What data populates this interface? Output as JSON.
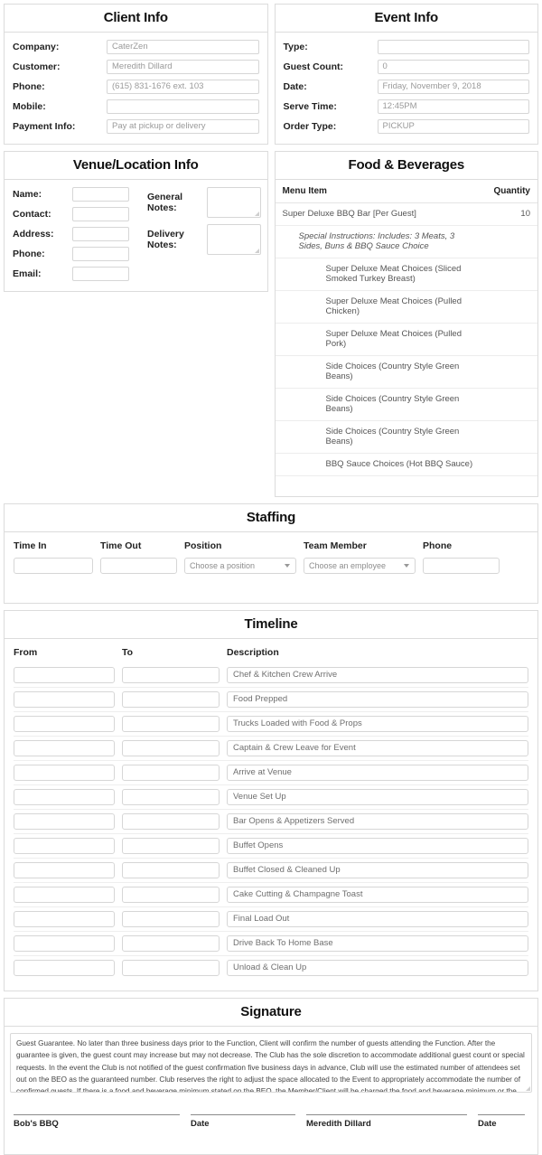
{
  "client_info": {
    "title": "Client Info",
    "fields": [
      {
        "label": "Company:",
        "value": "CaterZen"
      },
      {
        "label": "Customer:",
        "value": "Meredith Dillard"
      },
      {
        "label": "Phone:",
        "value": "(615) 831-1676 ext. 103"
      },
      {
        "label": "Mobile:",
        "value": ""
      },
      {
        "label": "Payment Info:",
        "value": "Pay at pickup or delivery"
      }
    ]
  },
  "event_info": {
    "title": "Event Info",
    "fields": [
      {
        "label": "Type:",
        "value": ""
      },
      {
        "label": "Guest Count:",
        "value": "0"
      },
      {
        "label": "Date:",
        "value": "Friday, November 9, 2018"
      },
      {
        "label": "Serve Time:",
        "value": "12:45PM"
      },
      {
        "label": "Order Type:",
        "value": "PICKUP"
      }
    ]
  },
  "venue_info": {
    "title": "Venue/Location Info",
    "fields": [
      {
        "label": "Name:",
        "value": ""
      },
      {
        "label": "Contact:",
        "value": ""
      },
      {
        "label": "Address:",
        "value": ""
      },
      {
        "label": "Phone:",
        "value": ""
      },
      {
        "label": "Email:",
        "value": ""
      }
    ],
    "notes": [
      {
        "label": "General Notes:",
        "value": ""
      },
      {
        "label": "Delivery Notes:",
        "value": ""
      }
    ]
  },
  "food_beverages": {
    "title": "Food & Beverages",
    "columns": {
      "item": "Menu Item",
      "quantity": "Quantity"
    },
    "rows": [
      {
        "indent": 0,
        "text": "Super Deluxe BBQ Bar [Per Guest]",
        "quantity": "10"
      },
      {
        "indent": 1,
        "text": "Special Instructions: Includes: 3 Meats, 3 Sides, Buns & BBQ Sauce Choice",
        "quantity": ""
      },
      {
        "indent": 2,
        "text": "Super Deluxe Meat Choices (Sliced Smoked Turkey Breast)",
        "quantity": ""
      },
      {
        "indent": 2,
        "text": "Super Deluxe Meat Choices (Pulled Chicken)",
        "quantity": ""
      },
      {
        "indent": 2,
        "text": "Super Deluxe Meat Choices (Pulled Pork)",
        "quantity": ""
      },
      {
        "indent": 2,
        "text": "Side Choices (Country Style Green Beans)",
        "quantity": ""
      },
      {
        "indent": 2,
        "text": "Side Choices (Country Style Green Beans)",
        "quantity": ""
      },
      {
        "indent": 2,
        "text": "Side Choices (Country Style Green Beans)",
        "quantity": ""
      },
      {
        "indent": 2,
        "text": "BBQ Sauce Choices (Hot BBQ Sauce)",
        "quantity": ""
      }
    ]
  },
  "staffing": {
    "title": "Staffing",
    "columns": [
      "Time In",
      "Time Out",
      "Position",
      "Team Member",
      "Phone"
    ],
    "row": {
      "time_in": "",
      "time_out": "",
      "position_placeholder": "Choose a position",
      "team_member_placeholder": "Choose an employee",
      "phone": ""
    }
  },
  "timeline": {
    "title": "Timeline",
    "columns": [
      "From",
      "To",
      "Description"
    ],
    "rows": [
      {
        "from": "",
        "to": "",
        "description": "Chef & Kitchen Crew Arrive"
      },
      {
        "from": "",
        "to": "",
        "description": "Food Prepped"
      },
      {
        "from": "",
        "to": "",
        "description": "Trucks Loaded with Food & Props"
      },
      {
        "from": "",
        "to": "",
        "description": "Captain & Crew Leave for Event"
      },
      {
        "from": "",
        "to": "",
        "description": "Arrive at Venue"
      },
      {
        "from": "",
        "to": "",
        "description": "Venue Set Up"
      },
      {
        "from": "",
        "to": "",
        "description": "Bar Opens & Appetizers Served"
      },
      {
        "from": "",
        "to": "",
        "description": "Buffet Opens"
      },
      {
        "from": "",
        "to": "",
        "description": "Buffet Closed & Cleaned Up"
      },
      {
        "from": "",
        "to": "",
        "description": "Cake Cutting & Champagne Toast"
      },
      {
        "from": "",
        "to": "",
        "description": "Final Load Out"
      },
      {
        "from": "",
        "to": "",
        "description": "Drive Back To Home Base"
      },
      {
        "from": "",
        "to": "",
        "description": "Unload & Clean Up"
      }
    ]
  },
  "signature": {
    "title": "Signature",
    "terms": "Guest Guarantee.  No later than three business days prior to the Function, Client will confirm the number of guests attending the Function.  After the guarantee is given, the guest count may increase but may not decrease.  The Club has the sole discretion to accommodate additional guest count or special requests.  In the event the Club is not notified of the guest confirmation five business days in advance, Club will use the estimated number of attendees set out on the BEO as the guaranteed number.  Club reserves the right to adjust the space allocated to the Event to appropriately accommodate the number of confirmed guests.  If there is a food and beverage minimum stated on the BEO, the Member/Client will be charged the food and beverage minimum or the actual food and beverage charges, whichever is greater.  If there is no food",
    "lines": [
      {
        "name": "Bob's BBQ"
      },
      {
        "name": "Date"
      },
      {
        "name": "Meredith Dillard"
      },
      {
        "name": "Date"
      }
    ]
  }
}
